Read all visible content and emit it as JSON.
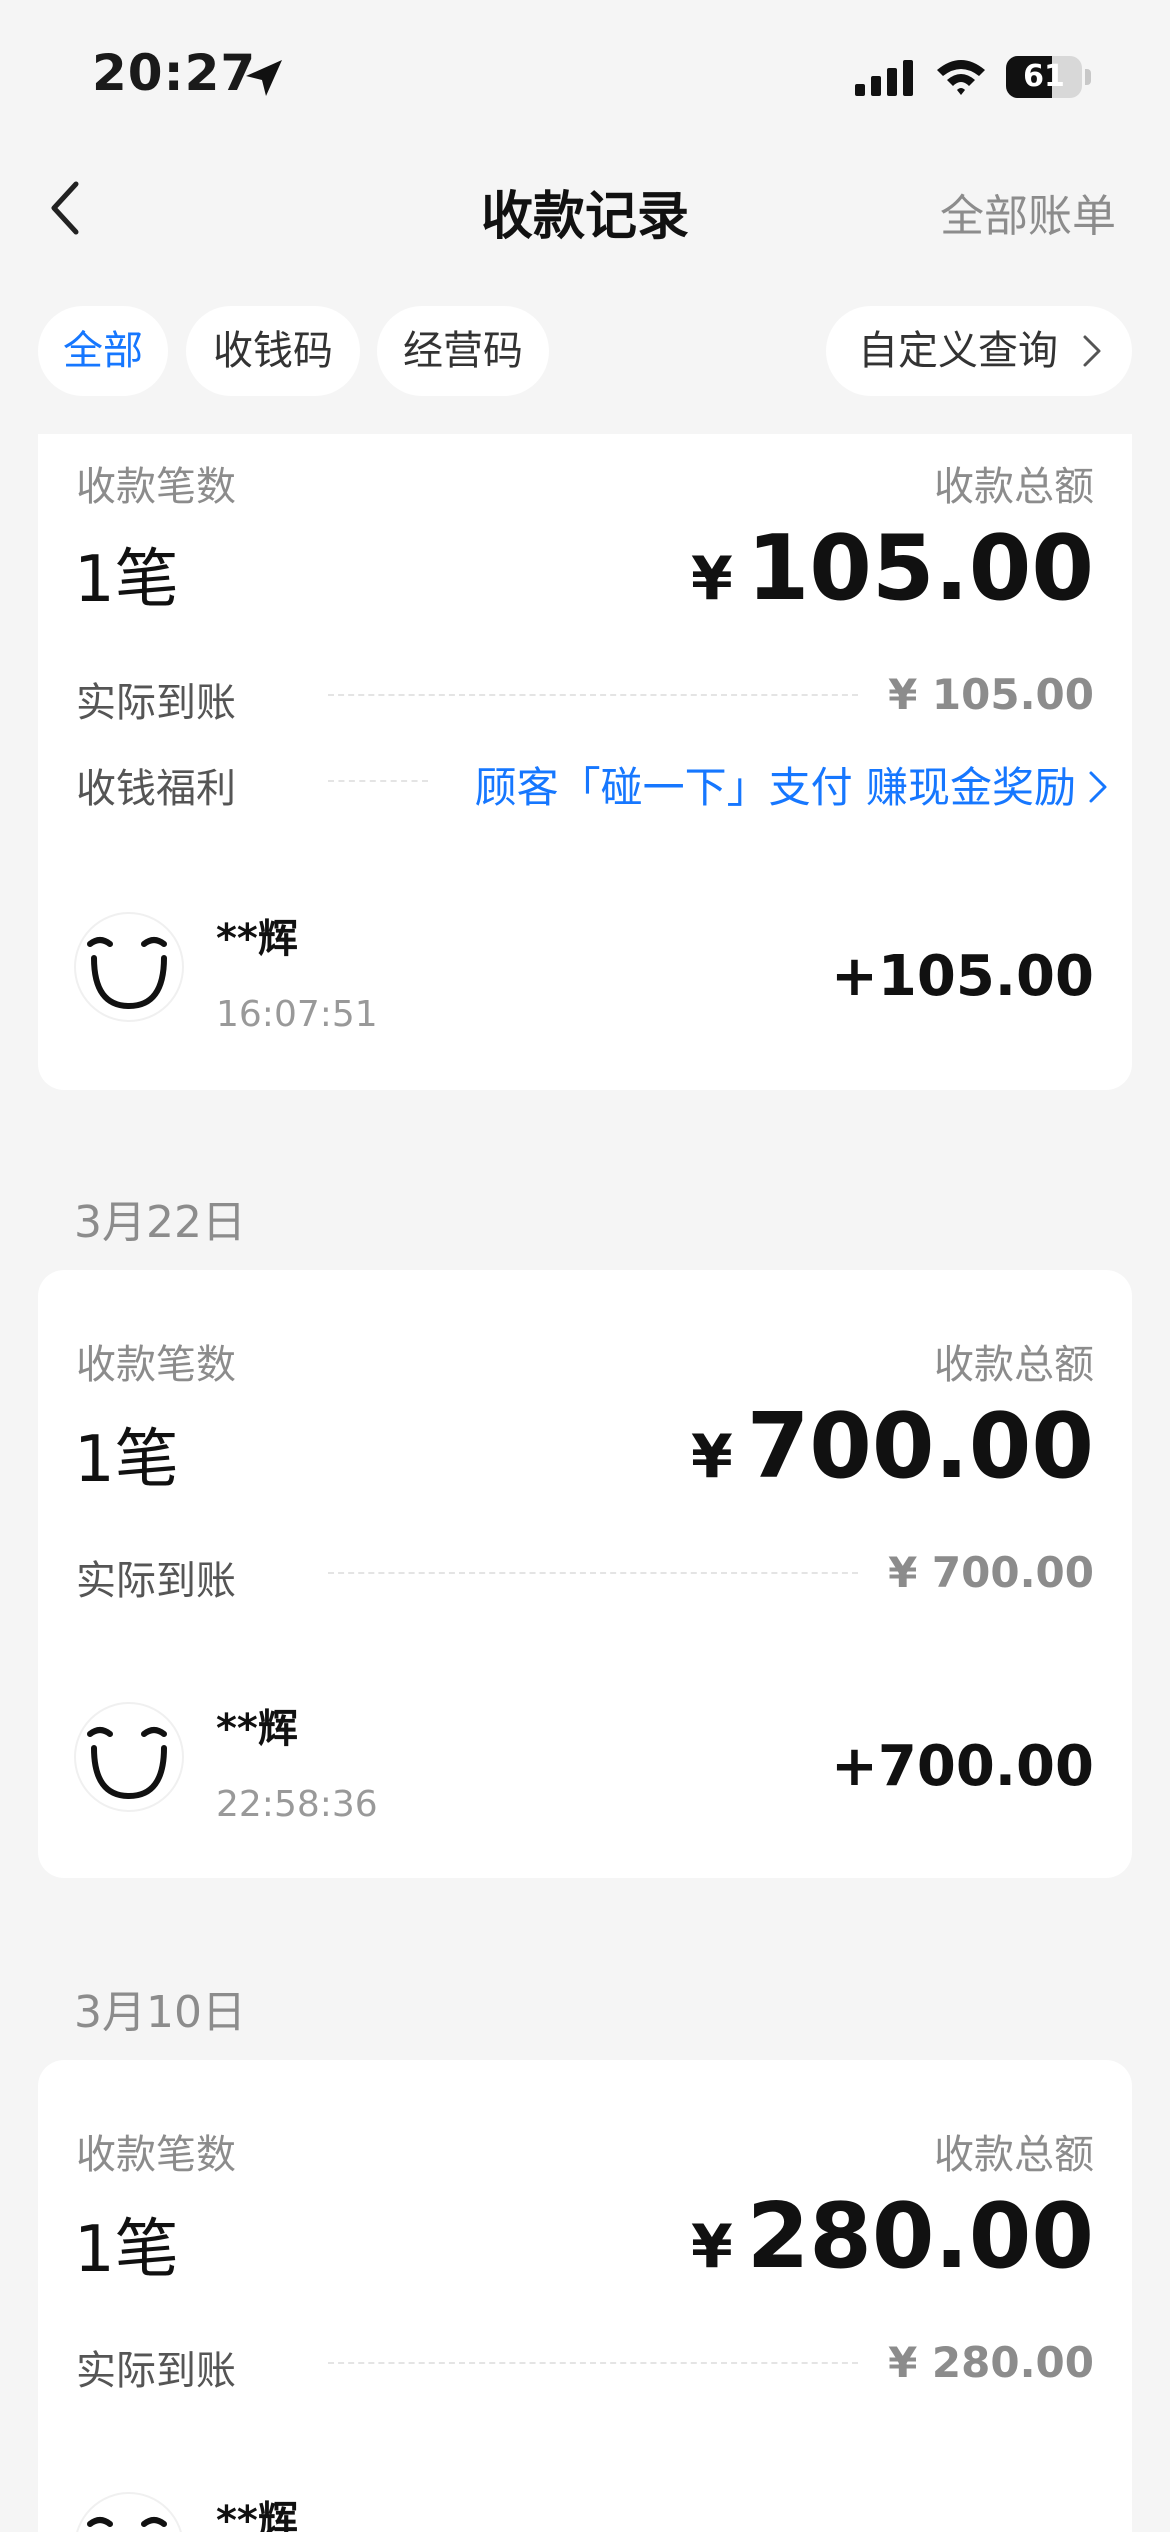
{
  "status_bar": {
    "time": "20:27",
    "battery": "61",
    "battery_level": 0.61
  },
  "nav": {
    "title": "收款记录",
    "right_label": "全部账单"
  },
  "filters": {
    "all": "全部",
    "qr": "收钱码",
    "business": "经营码",
    "custom": "自定义查询"
  },
  "labels": {
    "count": "收款笔数",
    "total": "收款总额",
    "received": "实际到账",
    "benefit": "收钱福利",
    "currency": "¥"
  },
  "promo": "顾客「碰一下」支付 赚现金奖励",
  "groups": [
    {
      "date": "",
      "count": "1笔",
      "total": "105.00",
      "received": "¥ 105.00",
      "transactions": [
        {
          "payer": "**辉",
          "time": "16:07:51",
          "amount": "+105.00"
        }
      ]
    },
    {
      "date": "3月22日",
      "count": "1笔",
      "total": "700.00",
      "received": "¥ 700.00",
      "transactions": [
        {
          "payer": "**辉",
          "time": "22:58:36",
          "amount": "+700.00"
        }
      ]
    },
    {
      "date": "3月10日",
      "count": "1笔",
      "total": "280.00",
      "received": "¥ 280.00",
      "transactions": [
        {
          "payer": "**辉",
          "time": "",
          "amount": ""
        }
      ]
    }
  ]
}
